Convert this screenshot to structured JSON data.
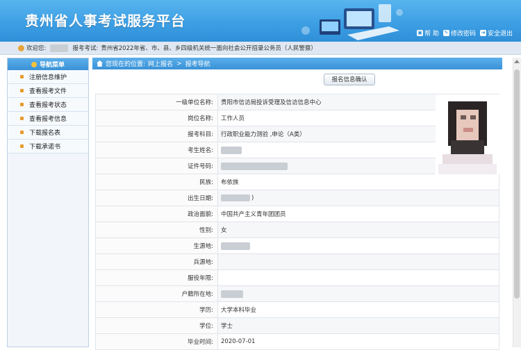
{
  "header": {
    "title": "贵州省人事考试服务平台",
    "links": [
      {
        "icon": "lock-icon",
        "label": "帮 助"
      },
      {
        "icon": "edit-icon",
        "label": "修改密码"
      },
      {
        "icon": "exit-icon",
        "label": "安全退出"
      }
    ]
  },
  "infobar": {
    "welcome": "欢迎您:",
    "exam_label": "报考考试:",
    "exam_name": "贵州省2022年省、市、县、乡四级机关统一面向社会公开招录公务员（人民警察）"
  },
  "sidebar": {
    "title": "导航菜单",
    "items": [
      {
        "label": "注册信息维护"
      },
      {
        "label": "查看报考文件"
      },
      {
        "label": "查看报考状态"
      },
      {
        "label": "查看报考信息"
      },
      {
        "label": "下载报名表"
      },
      {
        "label": "下载承诺书"
      }
    ]
  },
  "breadcrumb": {
    "prefix": "您现在的位置:",
    "level1": "网上报名",
    "separator": ">",
    "level2": "报考导航"
  },
  "confirm_button": "报名信息确认",
  "fields": [
    {
      "label": "一级单位名称:",
      "value": "贵阳市信访局投诉受理及信访信息中心"
    },
    {
      "label": "岗位名称:",
      "value": "工作人员"
    },
    {
      "label": "报考科目:",
      "value": "行政职业能力测验 ,申论（A类）"
    },
    {
      "label": "考生姓名:",
      "value": ""
    },
    {
      "label": "证件号码:",
      "value": ""
    },
    {
      "label": "民族:",
      "value": "布依族"
    },
    {
      "label": "出生日期:",
      "value": ")"
    },
    {
      "label": "政治面貌:",
      "value": "中国共产主义青年团团员"
    },
    {
      "label": "性别:",
      "value": "女"
    },
    {
      "label": "生源地:",
      "value": ""
    },
    {
      "label": "兵源地:",
      "value": ""
    },
    {
      "label": "服役年限:",
      "value": ""
    },
    {
      "label": "户籍所在地:",
      "value": ""
    },
    {
      "label": "学历:",
      "value": "大学本科毕业"
    },
    {
      "label": "学位:",
      "value": "学士"
    },
    {
      "label": "毕业时间:",
      "value": "2020-07-01"
    }
  ]
}
